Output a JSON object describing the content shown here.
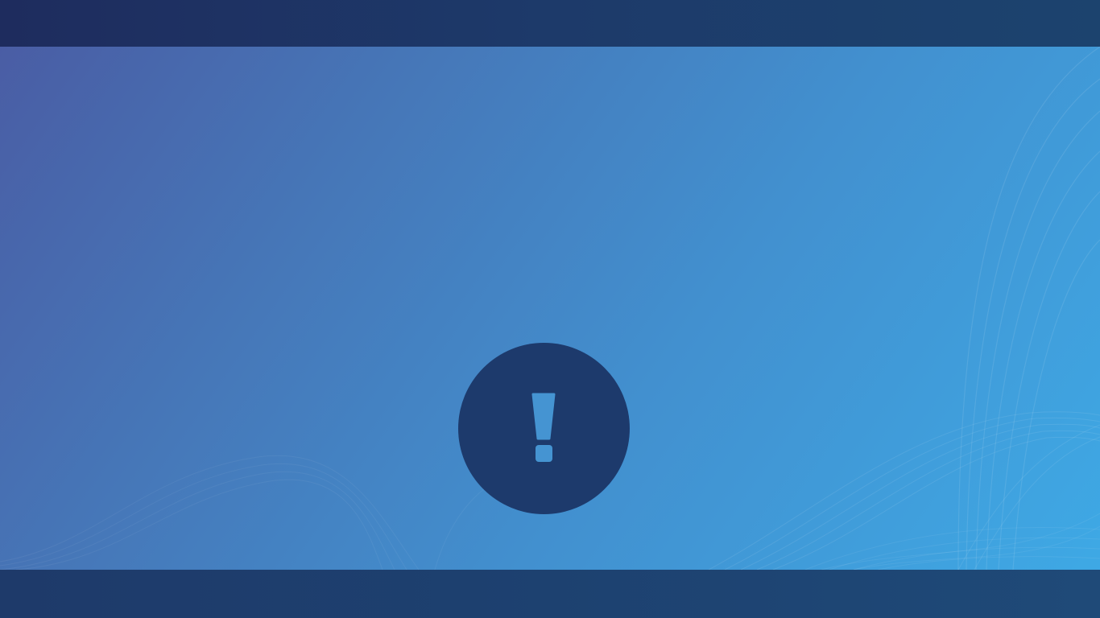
{
  "screen": {
    "state": "error",
    "icon": "exclamation-icon",
    "colors": {
      "bars": "#1d3a6a",
      "badge": "#1d3a6c",
      "glyph": "#4594d2",
      "gradient_start": "#4a5ba3",
      "gradient_end": "#3eaae6"
    }
  }
}
